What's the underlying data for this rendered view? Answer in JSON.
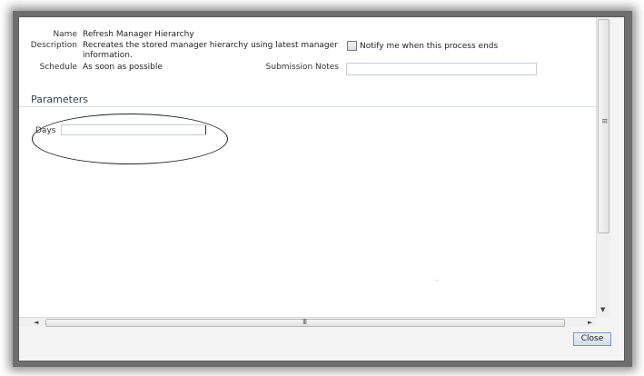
{
  "process": {
    "name_label": "Name",
    "name_value": "Refresh Manager Hierarchy",
    "description_label": "Description",
    "description_line1": "Recreates the stored manager hierarchy using latest manager",
    "description_line2": "information.",
    "schedule_label": "Schedule",
    "schedule_value": "As soon as possible",
    "notify_label": "Notify me when this process ends",
    "notify_checked": false,
    "submission_notes_label": "Submission Notes",
    "submission_notes_value": ""
  },
  "parameters": {
    "title": "Parameters",
    "days_label": "Days",
    "days_value": ""
  },
  "scrollbars": {
    "vertical_grip": "≡",
    "horizontal_grip": "III",
    "left_arrow": "◄",
    "right_arrow": "►",
    "down_arrow": "▼"
  },
  "footer": {
    "close_label": "Close"
  }
}
